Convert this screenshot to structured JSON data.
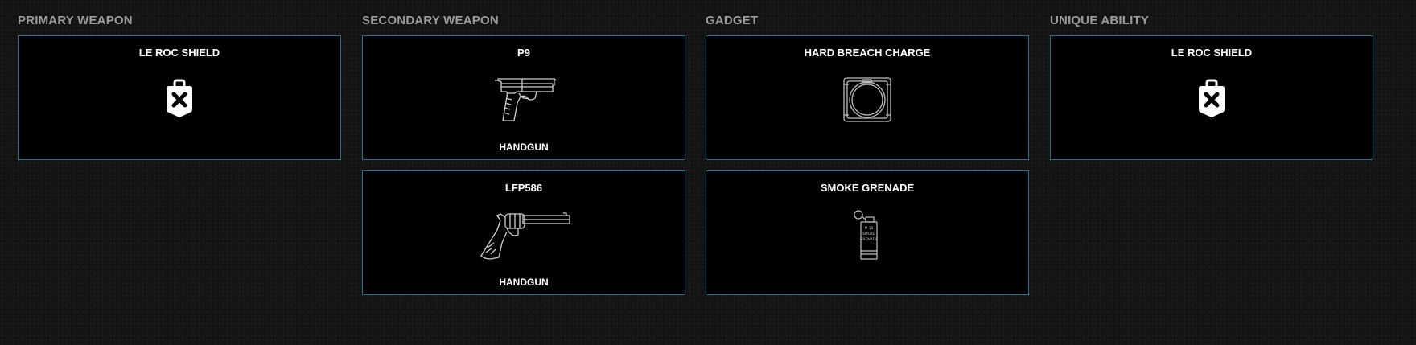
{
  "columns": {
    "primary": {
      "title": "PRIMARY WEAPON",
      "items": [
        {
          "name": "LE ROC SHIELD",
          "icon": "shield-badge-icon"
        }
      ]
    },
    "secondary": {
      "title": "SECONDARY WEAPON",
      "items": [
        {
          "name": "P9",
          "type": "HANDGUN",
          "icon": "pistol-icon"
        },
        {
          "name": "LFP586",
          "type": "HANDGUN",
          "icon": "revolver-icon"
        }
      ]
    },
    "gadget": {
      "title": "GADGET",
      "items": [
        {
          "name": "HARD BREACH CHARGE",
          "icon": "breach-charge-icon"
        },
        {
          "name": "SMOKE GRENADE",
          "icon": "smoke-grenade-icon",
          "label_lines": [
            "M 18",
            "SMOKE",
            "GRENADE"
          ]
        }
      ]
    },
    "ability": {
      "title": "UNIQUE ABILITY",
      "items": [
        {
          "name": "LE ROC SHIELD",
          "icon": "shield-badge-icon"
        }
      ]
    }
  },
  "colors": {
    "card_border": "#2b6f86",
    "card_bg": "#000000",
    "heading": "#9c9c9c",
    "text": "#ffffff"
  }
}
